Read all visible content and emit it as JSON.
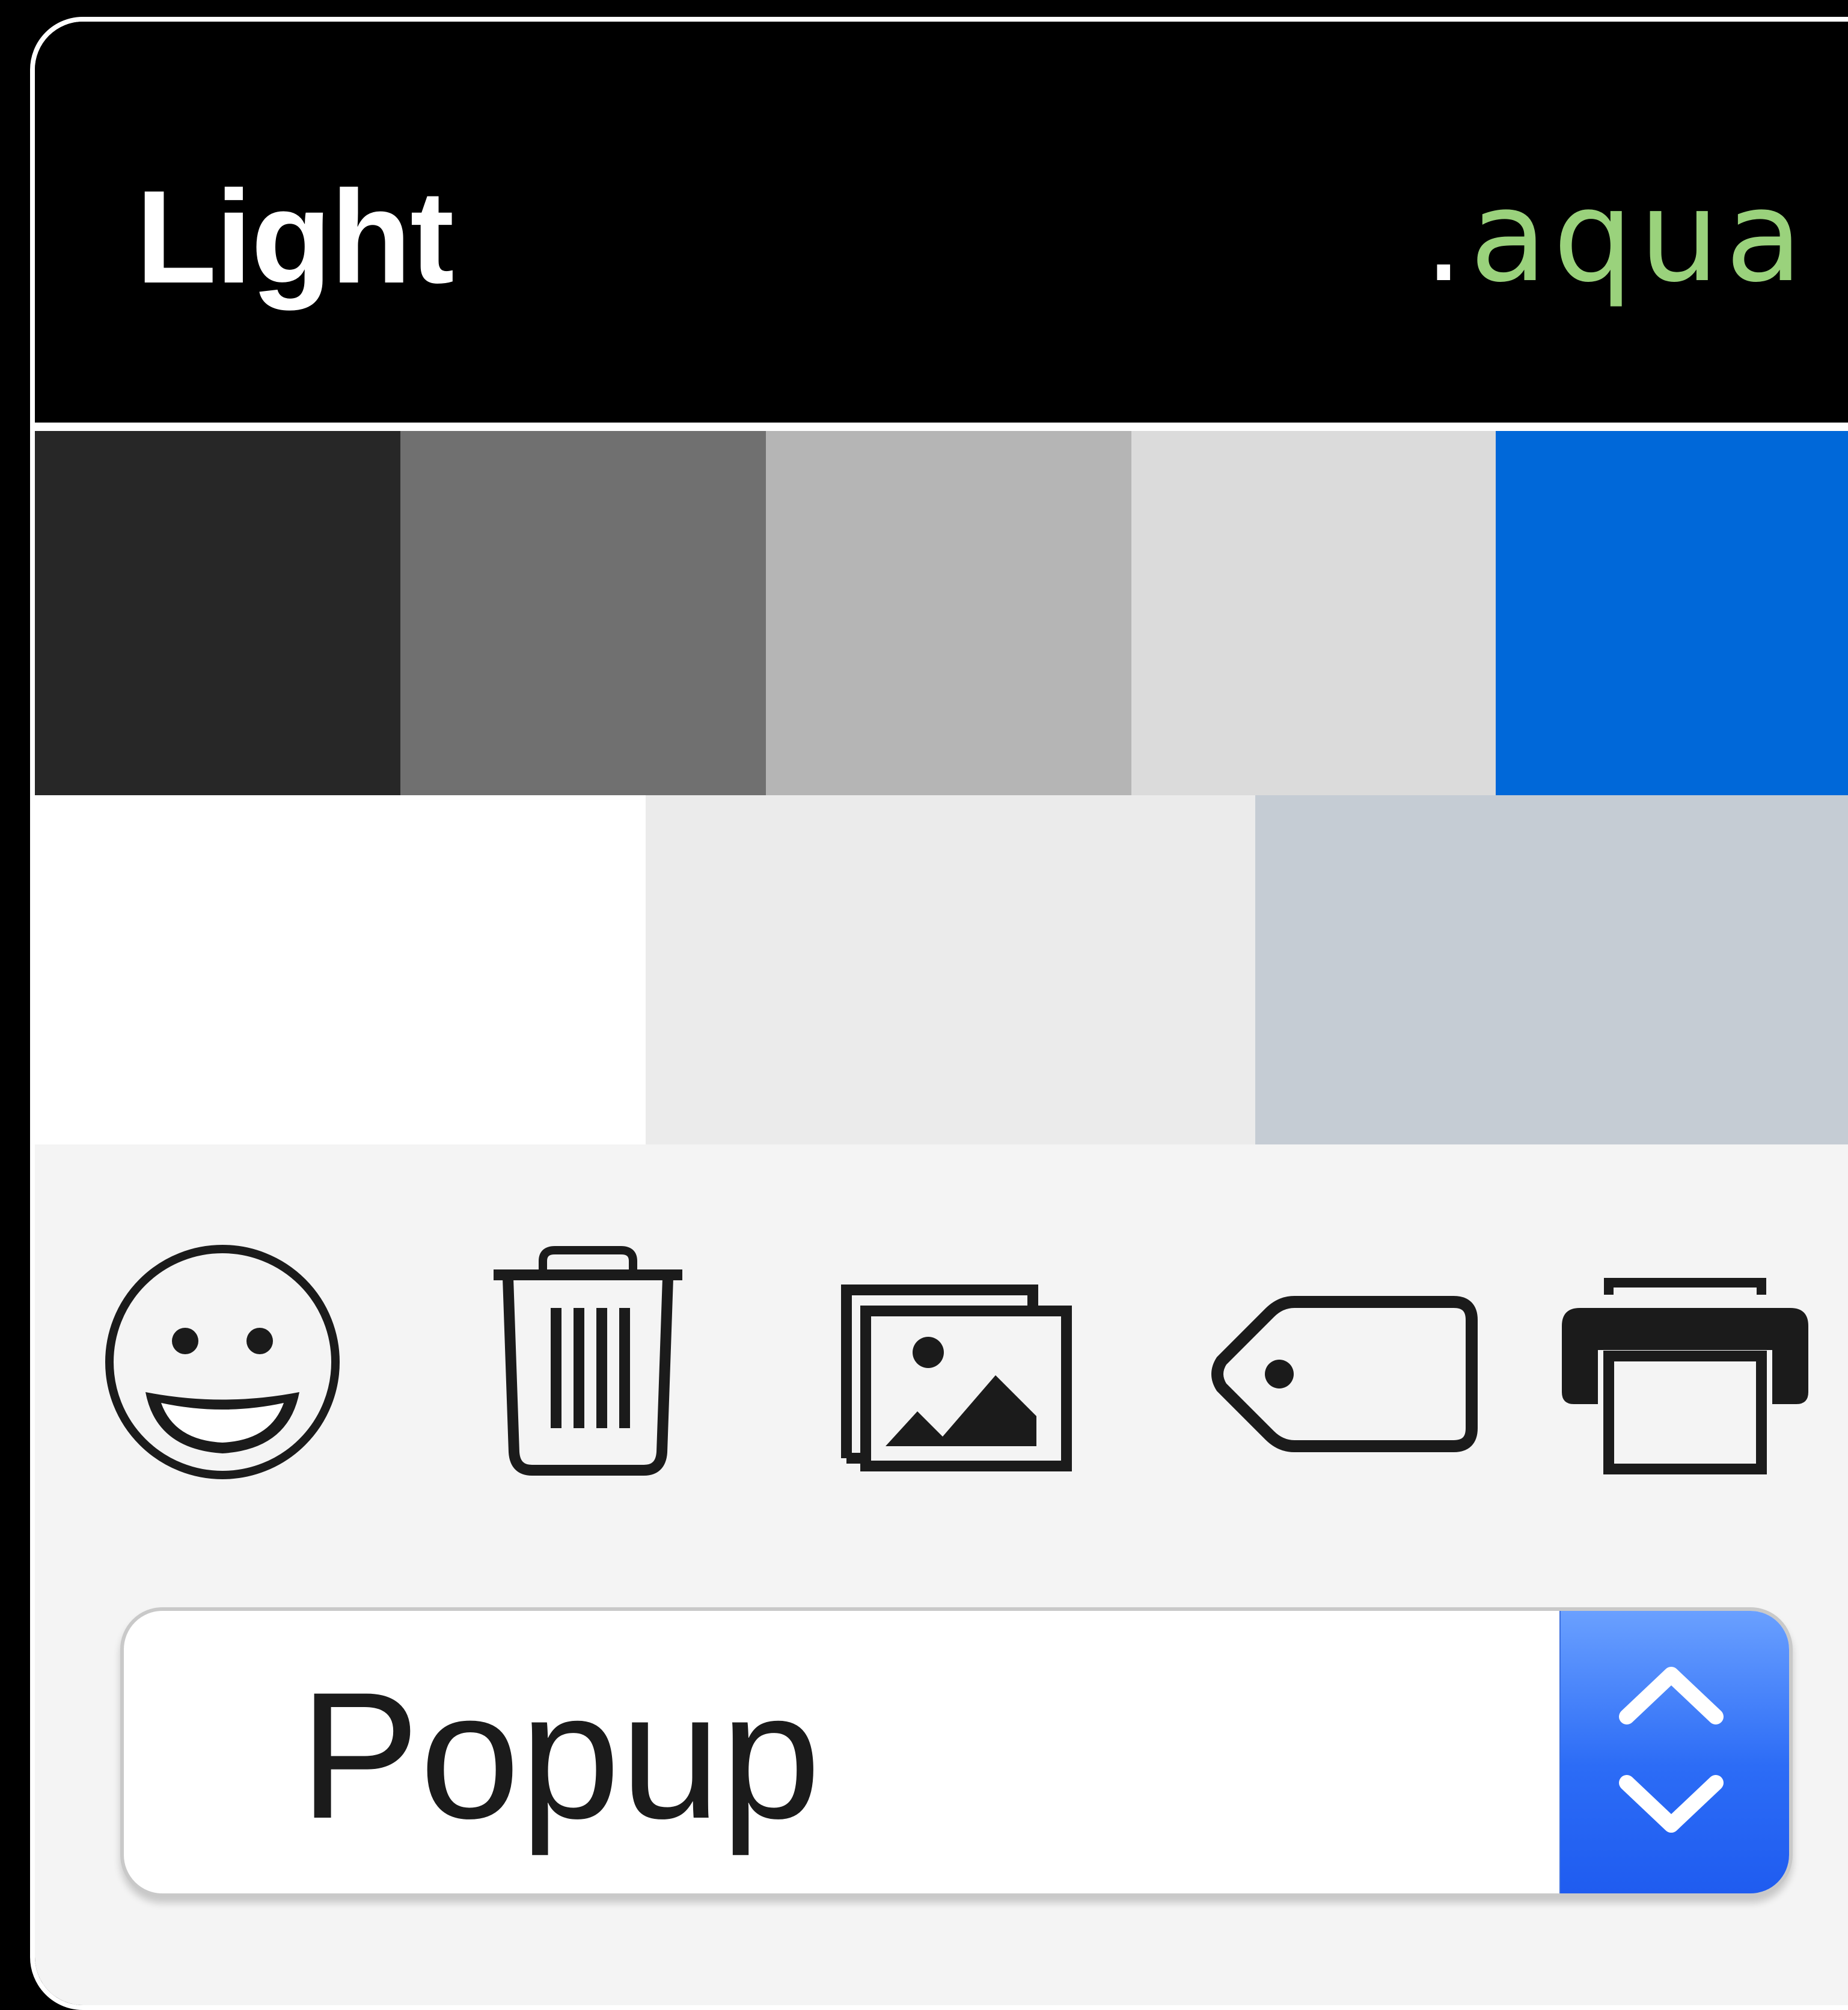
{
  "header": {
    "title": "Light",
    "theme_dot": ".",
    "theme_name": "aqua"
  },
  "colors": {
    "background": "#000000",
    "title_text": "#ffffff",
    "theme_name_text": "#9ad27c",
    "content_background": "#f4f4f4",
    "icon_color": "#1b1b1b",
    "popup_accent": "#2c6cf6"
  },
  "palette": {
    "row1": [
      "#272727",
      "#707070",
      "#b5b5b5",
      "#dbdbdb",
      "#0068d9"
    ],
    "row2": [
      "#ffffff",
      "#ebebeb",
      "#c5ccd4"
    ]
  },
  "icons": [
    "smiley-icon",
    "trash-icon",
    "photos-icon",
    "tag-icon",
    "printer-icon"
  ],
  "popup": {
    "label": "Popup",
    "stepper_icons": [
      "chevron-up-icon",
      "chevron-down-icon"
    ]
  }
}
